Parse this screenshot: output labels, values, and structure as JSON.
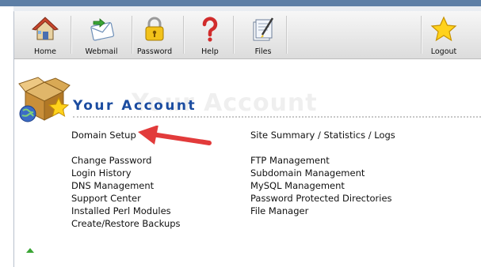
{
  "toolbar": {
    "home": "Home",
    "webmail": "Webmail",
    "password": "Password",
    "help": "Help",
    "files": "Files",
    "logout": "Logout"
  },
  "account": {
    "title": "Your Account",
    "ghost": "Your Account"
  },
  "links_left": [
    "Domain Setup",
    "Change Password",
    "Login History",
    "DNS Management",
    "Support Center",
    "Installed Perl Modules",
    "Create/Restore Backups"
  ],
  "links_right": [
    "Site Summary / Statistics / Logs",
    "FTP Management",
    "Subdomain Management",
    "MySQL Management",
    "Password Protected Directories",
    "File Manager"
  ],
  "colors": {
    "title": "#1b4ca0",
    "annotation_arrow": "#e23b3b"
  }
}
